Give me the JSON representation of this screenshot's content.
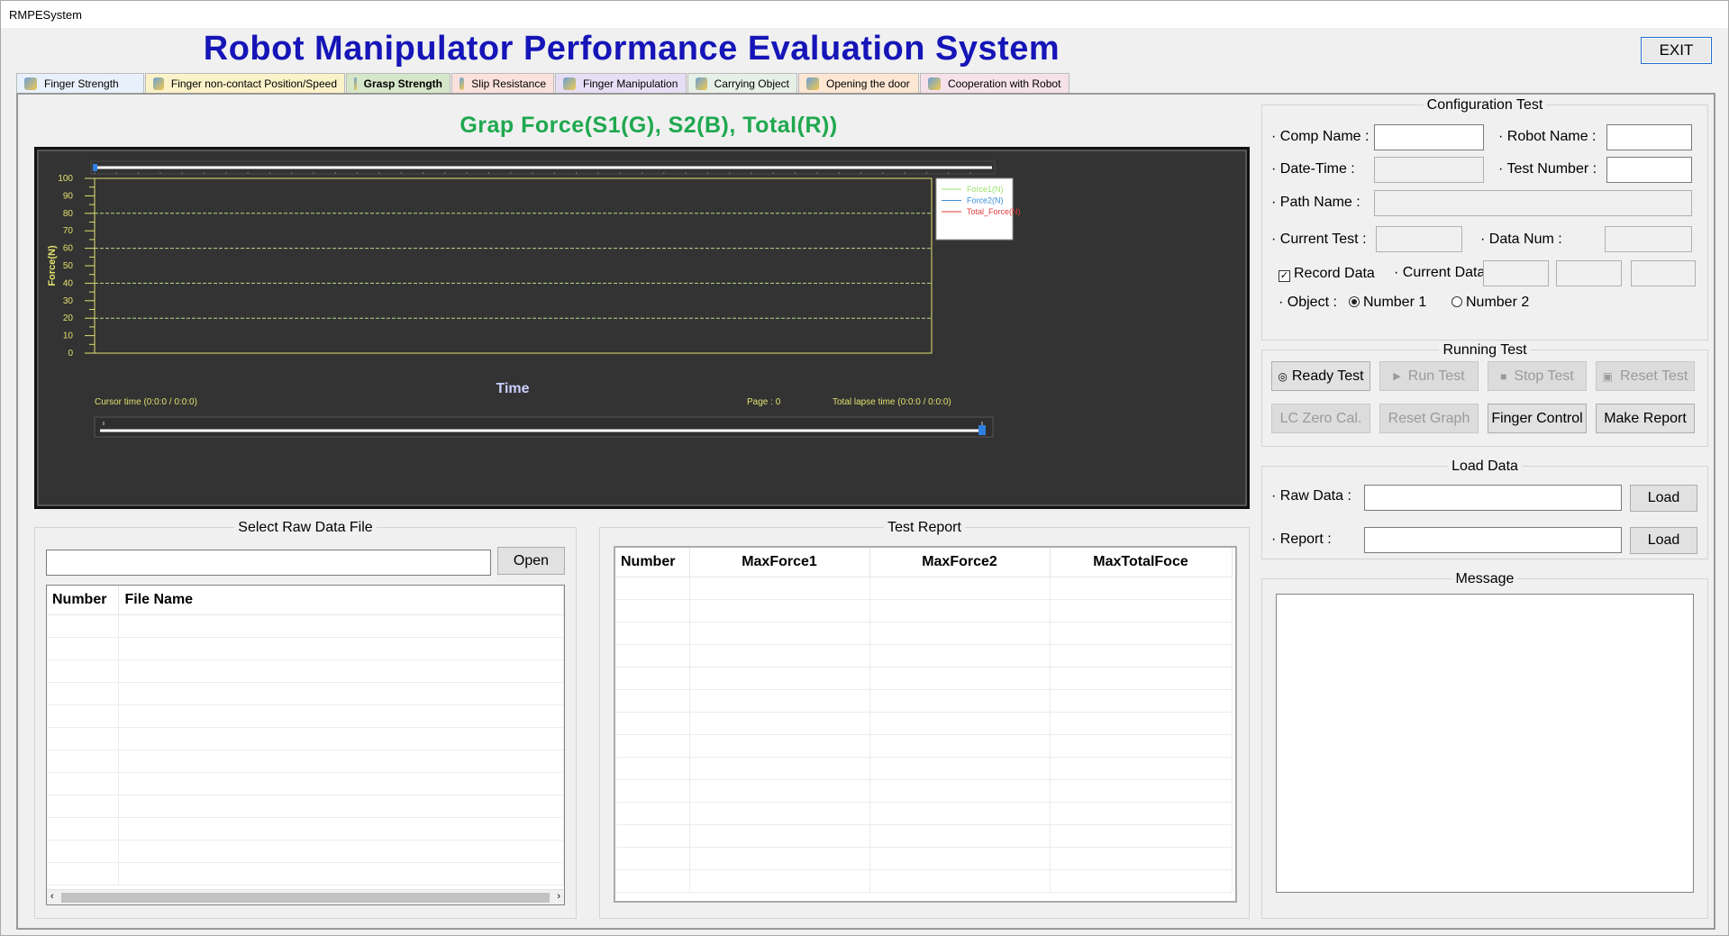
{
  "window": {
    "title": "RMPESystem"
  },
  "header": {
    "title": "Robot Manipulator Performance Evaluation System",
    "exit_label": "EXIT"
  },
  "tabs": [
    {
      "label": "Finger Strength",
      "color": "#e8f1fb",
      "icon": "hand-icon"
    },
    {
      "label": "Finger non-contact Position/Speed",
      "color": "#fbf2c9",
      "icon": "finger-icon"
    },
    {
      "label": "Grasp Strength",
      "color": "#d6e7c9",
      "icon": "grasp-icon",
      "active": true
    },
    {
      "label": "Slip Resistance",
      "color": "#fbe1dc",
      "icon": "globe-icon"
    },
    {
      "label": "Finger Manipulation",
      "color": "#e6def5",
      "icon": "manipulation-icon"
    },
    {
      "label": "Carrying Object",
      "color": "#e6f0e6",
      "icon": "carry-icon"
    },
    {
      "label": "Opening the door",
      "color": "#fde6d2",
      "icon": "door-icon"
    },
    {
      "label": "Cooperation with Robot",
      "color": "#f6e1ea",
      "icon": "robot-icon"
    }
  ],
  "chart": {
    "title": "Grap Force(S1(G), S2(B), Total(R))",
    "cursor_time": "Cursor time (0:0:0 / 0:0:0)",
    "page": "Page : 0",
    "total_lapse": "Total lapse time (0:0:0 / 0:0:0)"
  },
  "chart_data": {
    "type": "line",
    "xlabel": "Time",
    "ylabel": "Force(N)",
    "ylim": [
      0,
      100
    ],
    "yticks": [
      0,
      10,
      20,
      30,
      40,
      50,
      60,
      70,
      80,
      90,
      100
    ],
    "gridlines_y": [
      20,
      40,
      60,
      80
    ],
    "legend_position": "top-right",
    "series": [
      {
        "name": "Force1(N)",
        "color": "#9be26a",
        "values": []
      },
      {
        "name": "Force2(N)",
        "color": "#3a8fd8",
        "values": []
      },
      {
        "name": "Total_Force(N)",
        "color": "#e03a3a",
        "values": []
      }
    ]
  },
  "raw_data_file": {
    "title": "Select Raw Data File",
    "path_value": "",
    "open_label": "Open",
    "columns": [
      "Number",
      "File Name"
    ],
    "rows": []
  },
  "test_report": {
    "title": "Test Report",
    "columns": [
      "Number",
      "MaxForce1",
      "MaxForce2",
      "MaxTotalFoce"
    ],
    "rows": []
  },
  "config": {
    "title": "Configuration Test",
    "comp_name_label": "· Comp Name :",
    "robot_name_label": "· Robot Name :",
    "date_time_label": "· Date-Time :",
    "test_number_label": "· Test Number :",
    "path_name_label": "· Path Name :",
    "current_test_label": "· Current Test :",
    "data_num_label": "· Data Num :",
    "record_data_label": "Record Data",
    "current_data_label": "· Current Data :",
    "object_label": "· Object :",
    "number1_label": "Number 1",
    "number2_label": "Number 2"
  },
  "running": {
    "title": "Running Test",
    "ready": "Ready Test",
    "run": "Run Test",
    "stop": "Stop Test",
    "reset": "Reset Test",
    "lc_zero": "LC Zero Cal.",
    "reset_graph": "Reset Graph",
    "finger_control": "Finger Control",
    "make_report": "Make Report"
  },
  "load": {
    "title": "Load Data",
    "raw_data_label": "· Raw Data :",
    "report_label": "· Report :",
    "load_label": "Load"
  },
  "message": {
    "title": "Message"
  }
}
